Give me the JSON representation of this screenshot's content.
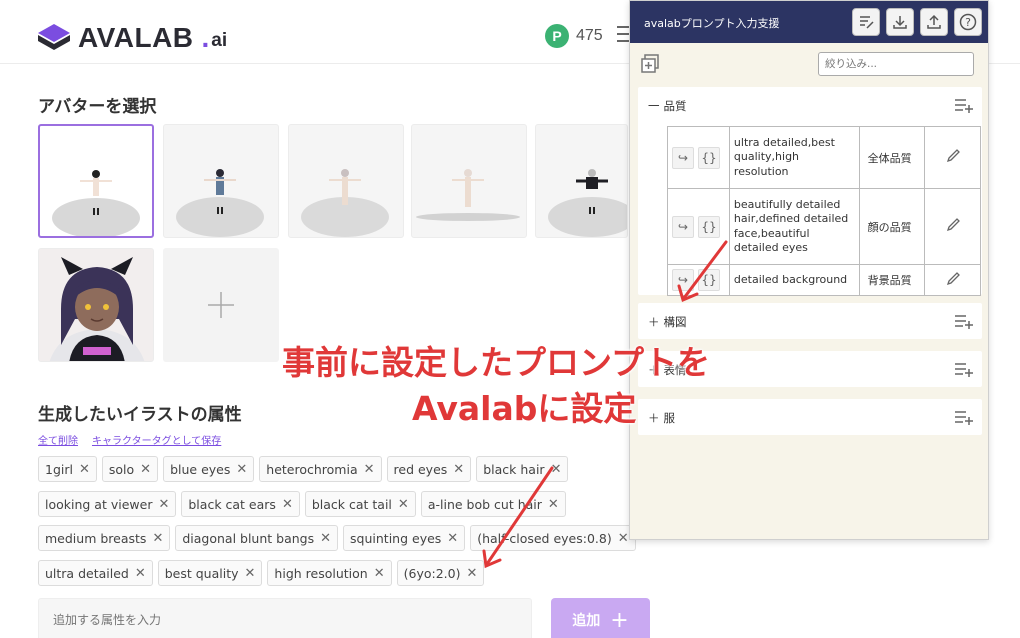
{
  "header": {
    "logo_text": "AVALAB",
    "logo_dot": ".",
    "logo_suffix": "ai",
    "points_icon": "P",
    "points_value": "475"
  },
  "avatar_section": {
    "title": "アバターを選択"
  },
  "attributes": {
    "title": "生成したいイラストの属性",
    "clear_all": "全て削除",
    "save_as_tag": "キャラクタータグとして保存",
    "rows": [
      [
        "1girl",
        "solo",
        "blue eyes",
        "heterochromia",
        "red eyes",
        "black hair"
      ],
      [
        "looking at viewer",
        "black cat ears",
        "black cat tail",
        "a-line bob cut hair"
      ],
      [
        "medium breasts",
        "diagonal blunt bangs",
        "squinting eyes",
        "(half-closed eyes:0.8)"
      ],
      [
        "ultra detailed",
        "best quality",
        "high resolution",
        "(6yo:2.0)"
      ]
    ],
    "remove_glyph": "✕",
    "input_placeholder": "追加する属性を入力",
    "add_button": "追加"
  },
  "panel": {
    "title": "avalabプロンプト入力支援",
    "filter_placeholder": "絞り込み...",
    "categories": [
      {
        "prefix": "一",
        "label": "品質"
      },
      {
        "prefix": "＋",
        "label": "構図"
      },
      {
        "prefix": "＋",
        "label": "表情"
      },
      {
        "prefix": "＋",
        "label": "服"
      }
    ],
    "prompts": [
      {
        "text": "ultra detailed,best quality,high resolution",
        "name": "全体品質"
      },
      {
        "text": "beautifully detailed hair,defined detailed face,beautiful detailed eyes",
        "name": "顔の品質"
      },
      {
        "text": "detailed background",
        "name": "背景品質"
      }
    ],
    "op_arrow": "↪",
    "op_braces": "{}"
  },
  "annotation": {
    "line1": "事前に設定したプロンプトを",
    "line2": "Avalabに設定",
    "color": "#e03838"
  }
}
